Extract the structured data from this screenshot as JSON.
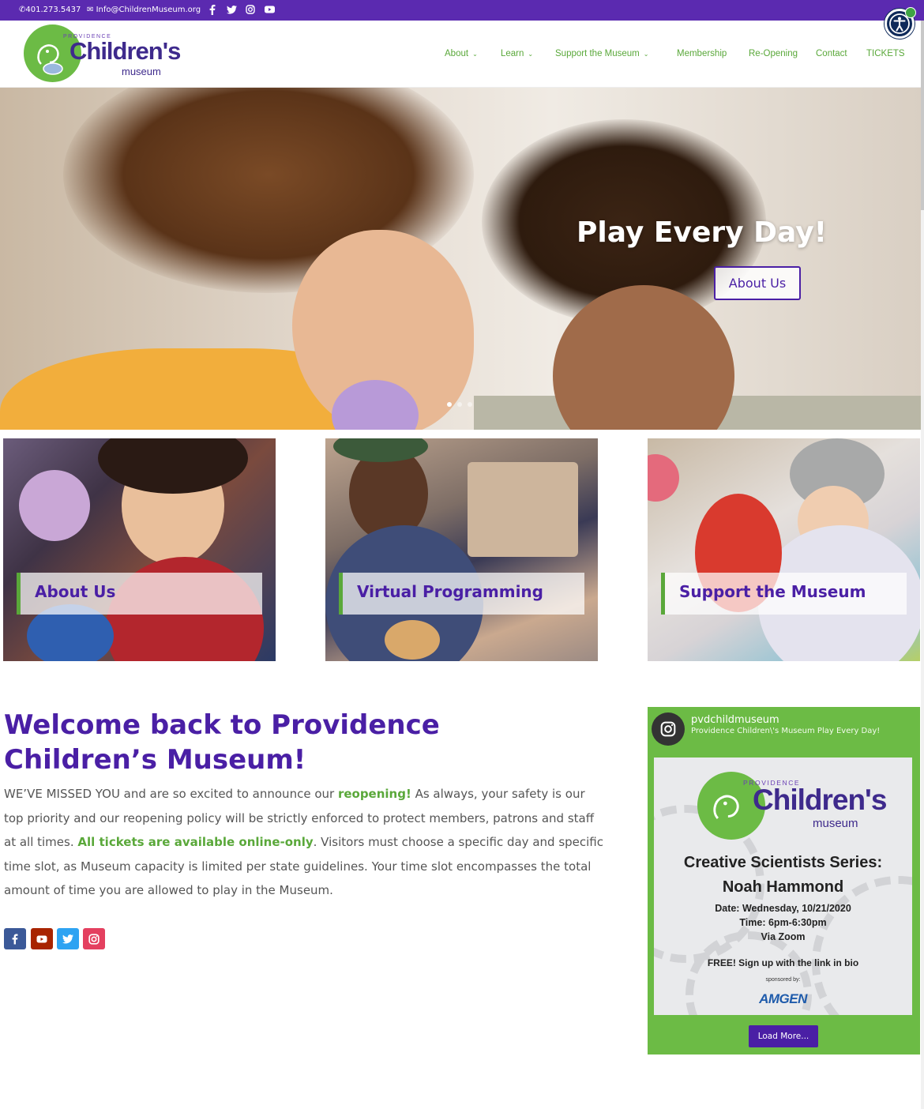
{
  "topbar": {
    "phone": "401.273.5437",
    "email": "Info@ChildrenMuseum.org",
    "social": [
      "facebook-icon",
      "twitter-icon",
      "instagram-icon",
      "youtube-icon"
    ]
  },
  "header": {
    "logo": {
      "providence": "PROVIDENCE",
      "childrens": "Children's",
      "museum": "museum"
    },
    "nav": [
      {
        "label": "About",
        "dropdown": true
      },
      {
        "label": "Learn",
        "dropdown": true
      },
      {
        "label": "Support the Museum",
        "dropdown": true
      },
      {
        "label": "Membership",
        "dropdown": false
      },
      {
        "label": "Re-Opening",
        "dropdown": false
      },
      {
        "label": "Contact",
        "dropdown": false
      },
      {
        "label": "TICKETS",
        "dropdown": false
      }
    ]
  },
  "hero": {
    "title": "Play Every Day!",
    "button": "About Us",
    "slides": 3,
    "active_slide": 1
  },
  "cards": [
    {
      "label": "About Us"
    },
    {
      "label": "Virtual Programming"
    },
    {
      "label": "Support the Museum"
    }
  ],
  "welcome": {
    "heading": "Welcome back to Providence Children’s Museum!",
    "p1": "WE’VE MISSED YOU and are so excited to announce our ",
    "link1": "reopening!",
    "p2": " As always, your safety is our top priority and our reopening policy will be strictly enforced to protect members, patrons and staff at all times. ",
    "link2": "All tickets are available online-only",
    "p3": ". Visitors must choose a specific day and specific time slot, as Museum capacity is limited per state guidelines. Your time slot encompasses the total amount of time you are allowed to play in the Museum.",
    "social": [
      "facebook-icon",
      "youtube-icon",
      "twitter-icon",
      "instagram-icon"
    ]
  },
  "instagram": {
    "username": "pvdchildmuseum",
    "bio": "Providence Children\\'s Museum Play Every Day!",
    "post": {
      "providence": "PROVIDENCE",
      "childrens": "Children's",
      "museum": "museum",
      "title_line1": "Creative Scientists Series:",
      "title_line2": "Noah Hammond",
      "date": "Date: Wednesday, 10/21/2020",
      "time": "Time: 6pm-6:30pm",
      "via": "Via Zoom",
      "free": "FREE! Sign up with the link in bio",
      "sponsored": "sponsored by:",
      "sponsor": "AMGEN"
    },
    "load_more": "Load More..."
  },
  "colors": {
    "purple": "#5b2ab0",
    "deep_purple": "#4a1fa5",
    "green": "#6cbb45",
    "nav_green": "#5aa83a"
  }
}
